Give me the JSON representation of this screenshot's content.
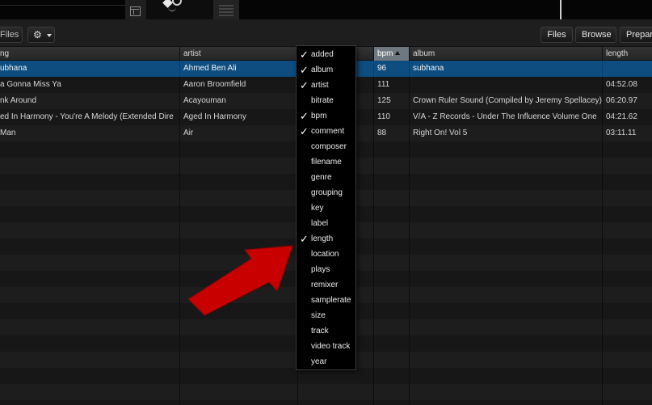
{
  "toolbar": {
    "files_left": "Files",
    "gear_icon": "gear-icon",
    "files_right": "Files",
    "browse": "Browse",
    "prepare": "Prepare"
  },
  "columns": {
    "song": "ng",
    "artist": "artist",
    "bpm": "bpm",
    "album": "album",
    "length": "length"
  },
  "rows": [
    {
      "song": "ubhana",
      "artist": "Ahmed Ben Ali",
      "bpm": "96",
      "album": "subhana",
      "length": ""
    },
    {
      "song": "a Gonna Miss Ya",
      "artist": "Aaron Broomfield",
      "bpm": "111",
      "album": "",
      "length": "04:52.08"
    },
    {
      "song": "nk Around",
      "artist": "Acayouman",
      "bpm": "125",
      "album": "Crown Ruler Sound (Compiled by Jeremy Spellacey)",
      "length": "06:20.97"
    },
    {
      "song": "ed In Harmony - You're A Melody (Extended Dire",
      "artist": "Aged In Harmony",
      "bpm": "110",
      "album": "V/A - Z Records - Under The Influence Volume One",
      "length": "04:21.62"
    },
    {
      "song": " Man",
      "artist": "Air",
      "bpm": "88",
      "album": "Right On! Vol 5",
      "length": "03:11.11"
    }
  ],
  "menu": {
    "items": [
      {
        "label": "added",
        "checked": true
      },
      {
        "label": "album",
        "checked": true
      },
      {
        "label": "artist",
        "checked": true
      },
      {
        "label": "bitrate",
        "checked": false
      },
      {
        "label": "bpm",
        "checked": true
      },
      {
        "label": "comment",
        "checked": true
      },
      {
        "label": "composer",
        "checked": false
      },
      {
        "label": "filename",
        "checked": false
      },
      {
        "label": "genre",
        "checked": false
      },
      {
        "label": "grouping",
        "checked": false
      },
      {
        "label": "key",
        "checked": false
      },
      {
        "label": "label",
        "checked": false
      },
      {
        "label": "length",
        "checked": true
      },
      {
        "label": "location",
        "checked": false
      },
      {
        "label": "plays",
        "checked": false
      },
      {
        "label": "remixer",
        "checked": false
      },
      {
        "label": "samplerate",
        "checked": false
      },
      {
        "label": "size",
        "checked": false
      },
      {
        "label": "track",
        "checked": false
      },
      {
        "label": "video track",
        "checked": false
      },
      {
        "label": "year",
        "checked": false
      }
    ],
    "check_glyph": "✓"
  },
  "colors": {
    "selected_row": "#0d4d80",
    "arrow": "#c80000",
    "sorted_header": "#6f7880"
  }
}
